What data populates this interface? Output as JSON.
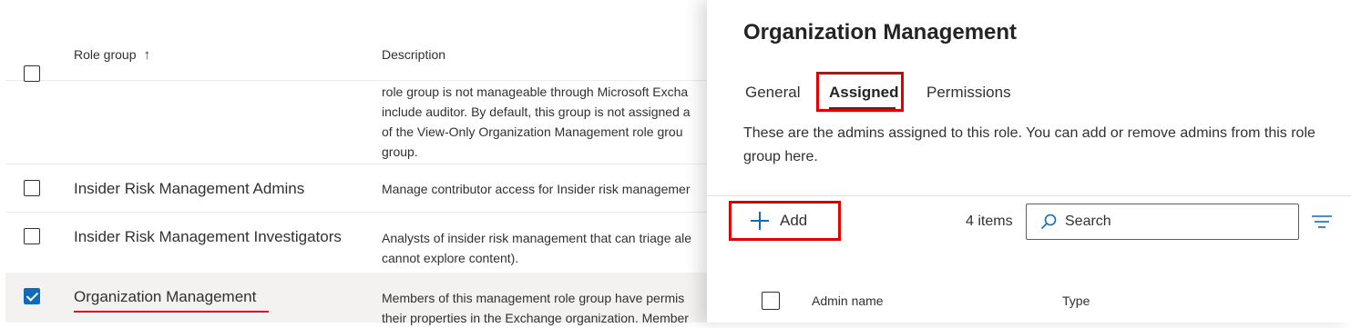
{
  "list": {
    "columns": {
      "role_group": "Role group",
      "description": "Description"
    },
    "rows": [
      {
        "name": "",
        "checked": false,
        "description_lines": [
          "role group is not manageable through Microsoft Excha",
          "include auditor. By default, this group is not assigned a",
          "of the View-Only Organization Management role grou",
          "group."
        ]
      },
      {
        "name": "Insider Risk Management Admins",
        "checked": false,
        "description_lines": [
          "Manage contributor access for Insider risk managemer"
        ]
      },
      {
        "name": "Insider Risk Management Investigators",
        "checked": false,
        "description_lines": [
          "Analysts of insider risk management that can triage ale",
          "cannot explore content)."
        ]
      },
      {
        "name": "Organization Management",
        "checked": true,
        "description_lines": [
          "Members of this management role group have permis",
          "their properties in the Exchange organization. Member"
        ]
      }
    ]
  },
  "panel": {
    "title": "Organization Management",
    "tabs": {
      "general": "General",
      "assigned": "Assigned",
      "permissions": "Permissions"
    },
    "active_tab": "Assigned",
    "description": "These are the admins assigned to this role. You can add or remove admins from this role group here.",
    "add_label": "Add",
    "items_count": "4 items",
    "search_placeholder": "Search",
    "table_columns": {
      "admin_name": "Admin name",
      "type": "Type"
    }
  },
  "colors": {
    "accent": "#0f6cbd",
    "highlight": "#e00000"
  }
}
